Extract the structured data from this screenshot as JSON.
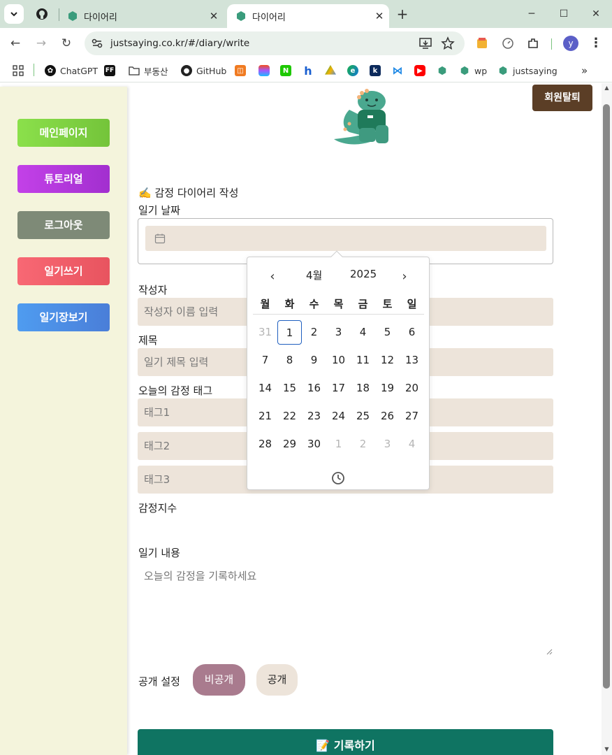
{
  "browser": {
    "tabs": [
      {
        "title": "다이어리",
        "active": false
      },
      {
        "title": "다이어리",
        "active": true
      }
    ],
    "url": "justsaying.co.kr/#/diary/write",
    "profile_initial": "y",
    "bookmarks": [
      {
        "label": "ChatGPT"
      },
      {
        "label": "부동산"
      },
      {
        "label": "GitHub"
      },
      {
        "label": "wp"
      },
      {
        "label": "justsaying"
      }
    ],
    "bookmark_badges": {
      "ff": "FF",
      "n": "N",
      "h": "h",
      "k": "k"
    }
  },
  "sidebar": {
    "items": [
      {
        "label": "메인페이지"
      },
      {
        "label": "튜토리얼"
      },
      {
        "label": "로그아웃"
      },
      {
        "label": "일기쓰기"
      },
      {
        "label": "일기장보기"
      }
    ]
  },
  "header": {
    "withdraw_label": "회원탈퇴"
  },
  "form": {
    "title": "✍️ 감정 다이어리 작성",
    "date_label": "일기 날짜",
    "author_label": "작성자",
    "author_placeholder": "작성자 이름 입력",
    "subject_label": "제목",
    "subject_placeholder": "일기 제목 입력",
    "tags_label": "오늘의 감정 태그",
    "tag_placeholders": [
      "태그1",
      "태그2",
      "태그3"
    ],
    "score_label": "감정지수",
    "content_label": "일기 내용",
    "content_placeholder": "오늘의 감정을 기록하세요",
    "visibility_label": "공개 설정",
    "private_label": "비공개",
    "public_label": "공개",
    "submit_label": "📝 기록하기"
  },
  "datepicker": {
    "month": "4월",
    "year": "2025",
    "weekdays": [
      "월",
      "화",
      "수",
      "목",
      "금",
      "토",
      "일"
    ],
    "days": [
      {
        "d": "31",
        "muted": true
      },
      {
        "d": "1",
        "today": true
      },
      {
        "d": "2"
      },
      {
        "d": "3"
      },
      {
        "d": "4"
      },
      {
        "d": "5"
      },
      {
        "d": "6"
      },
      {
        "d": "7"
      },
      {
        "d": "8"
      },
      {
        "d": "9"
      },
      {
        "d": "10"
      },
      {
        "d": "11"
      },
      {
        "d": "12"
      },
      {
        "d": "13"
      },
      {
        "d": "14"
      },
      {
        "d": "15"
      },
      {
        "d": "16"
      },
      {
        "d": "17"
      },
      {
        "d": "18"
      },
      {
        "d": "19"
      },
      {
        "d": "20"
      },
      {
        "d": "21"
      },
      {
        "d": "22"
      },
      {
        "d": "23"
      },
      {
        "d": "24"
      },
      {
        "d": "25"
      },
      {
        "d": "26"
      },
      {
        "d": "27"
      },
      {
        "d": "28"
      },
      {
        "d": "29"
      },
      {
        "d": "30"
      },
      {
        "d": "1",
        "muted": true
      },
      {
        "d": "2",
        "muted": true
      },
      {
        "d": "3",
        "muted": true
      },
      {
        "d": "4",
        "muted": true
      }
    ]
  },
  "colors": {
    "sidebar_bg": "#f4f4dc",
    "input_bg": "#ede4da",
    "submit_bg": "#0f7462",
    "withdraw_bg": "#5b3e26",
    "private_pill": "#a97b8e",
    "tab_strip": "#d3e3d8"
  }
}
